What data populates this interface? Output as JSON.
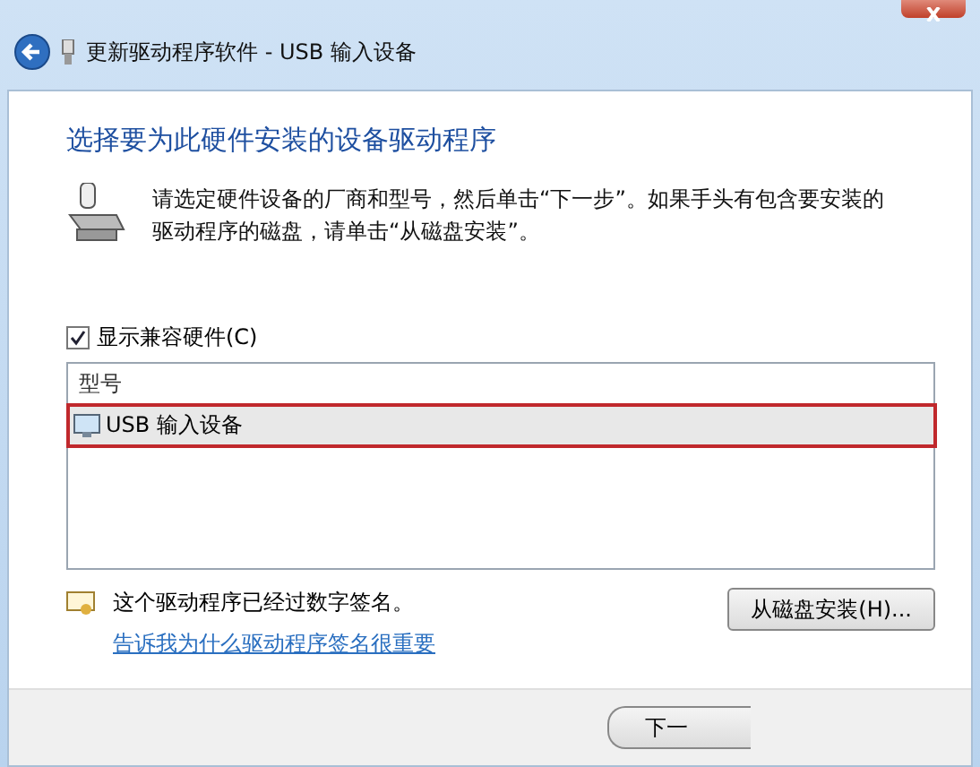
{
  "window": {
    "title": "更新驱动程序软件 - USB 输入设备"
  },
  "heading": "选择要为此硬件安装的设备驱动程序",
  "description": "请选定硬件设备的厂商和型号，然后单击“下一步”。如果手头有包含要安装的驱动程序的磁盘，请单击“从磁盘安装”。",
  "compatible_checkbox": {
    "label": "显示兼容硬件(C)",
    "checked": true
  },
  "model_list": {
    "column": "型号",
    "items": [
      {
        "label": "USB 输入设备",
        "selected": true,
        "highlighted": true
      }
    ]
  },
  "signature": {
    "text": "这个驱动程序已经过数字签名。",
    "link": "告诉我为什么驱动程序签名很重要"
  },
  "have_disk_button": "从磁盘安装(H)...",
  "footer_buttons": [
    "下一"
  ]
}
